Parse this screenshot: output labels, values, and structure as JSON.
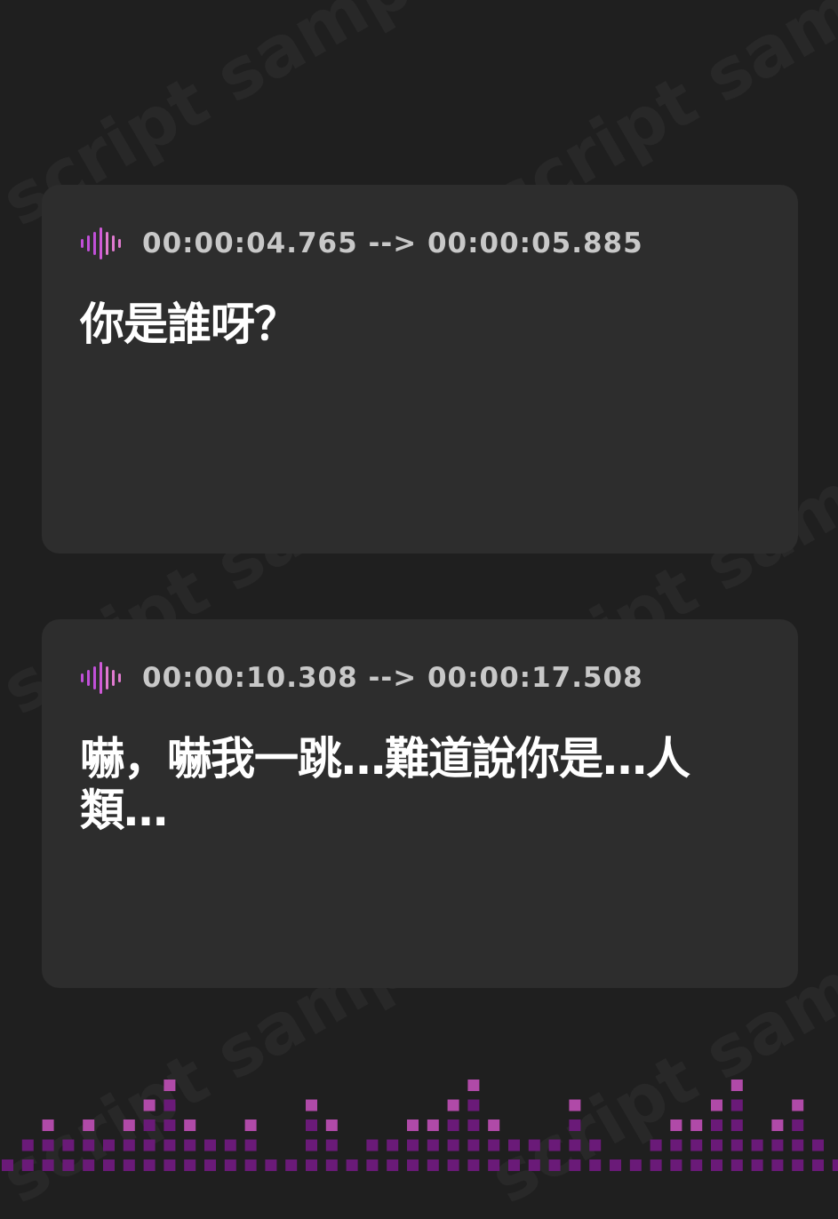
{
  "watermark": {
    "text": "script sample"
  },
  "cues": [
    {
      "icon": "audio-wave-icon",
      "timestamp": "00:00:04.765 --> 00:00:05.885",
      "text": "你是誰呀？"
    },
    {
      "icon": "audio-wave-icon",
      "timestamp": "00:00:10.308 --> 00:00:17.508",
      "text": "嚇，嚇我一跳…難道說你是…人類…"
    }
  ],
  "colors": {
    "background": "#1f1f1f",
    "card": "#2d2d2d",
    "accent_magenta": "#c04fd8",
    "accent_pink": "#e07ad0",
    "equalizer_dark": "#6a1a78",
    "equalizer_light": "#b04aa8"
  }
}
